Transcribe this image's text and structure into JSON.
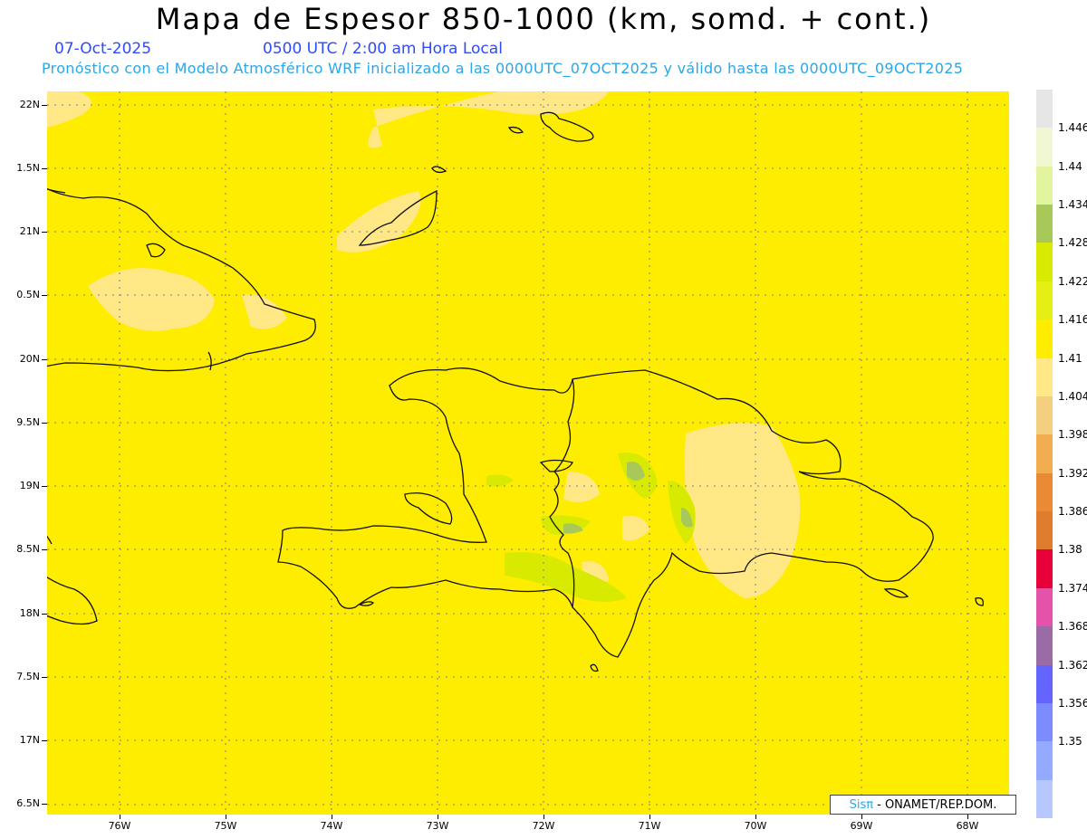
{
  "header": {
    "title": "Mapa de Espesor 850-1000 (km, somd. + cont.)",
    "date": "07-Oct-2025",
    "time": "0500 UTC / 2:00 am Hora Local",
    "forecast_note": "Pronóstico con el Modelo Atmosférico WRF inicializado a las 0000UTC_07OCT2025 y válido hasta las  0000UTC_09OCT2025"
  },
  "axes": {
    "lat_labels": [
      "22N",
      "1.5N",
      "21N",
      "0.5N",
      "20N",
      "9.5N",
      "19N",
      "8.5N",
      "18N",
      "7.5N",
      "17N",
      "6.5N"
    ],
    "lon_labels": [
      "76W",
      "75W",
      "74W",
      "73W",
      "72W",
      "71W",
      "70W",
      "69W",
      "68W"
    ]
  },
  "colorbar": {
    "labels": [
      "1.446",
      "1.44",
      "1.434",
      "1.428",
      "1.422",
      "1.416",
      "1.41",
      "1.404",
      "1.398",
      "1.392",
      "1.386",
      "1.38",
      "1.374",
      "1.368",
      "1.362",
      "1.356",
      "1.35"
    ],
    "colors": [
      "#e6e6e6",
      "#f0f5d2",
      "#e3f49e",
      "#a8c85a",
      "#d8ea00",
      "#e5ef14",
      "#ffed00",
      "#ffe885",
      "#f5cf80",
      "#f2ad50",
      "#ea8a34",
      "#e07c2e",
      "#e8003a",
      "#e552a9",
      "#9b6ba8",
      "#6464ff",
      "#7c8cff",
      "#94aaff",
      "#b6c8ff"
    ]
  },
  "credit": {
    "brand": "Sisπ",
    "text": "- ONAMET/REP.DOM."
  }
}
